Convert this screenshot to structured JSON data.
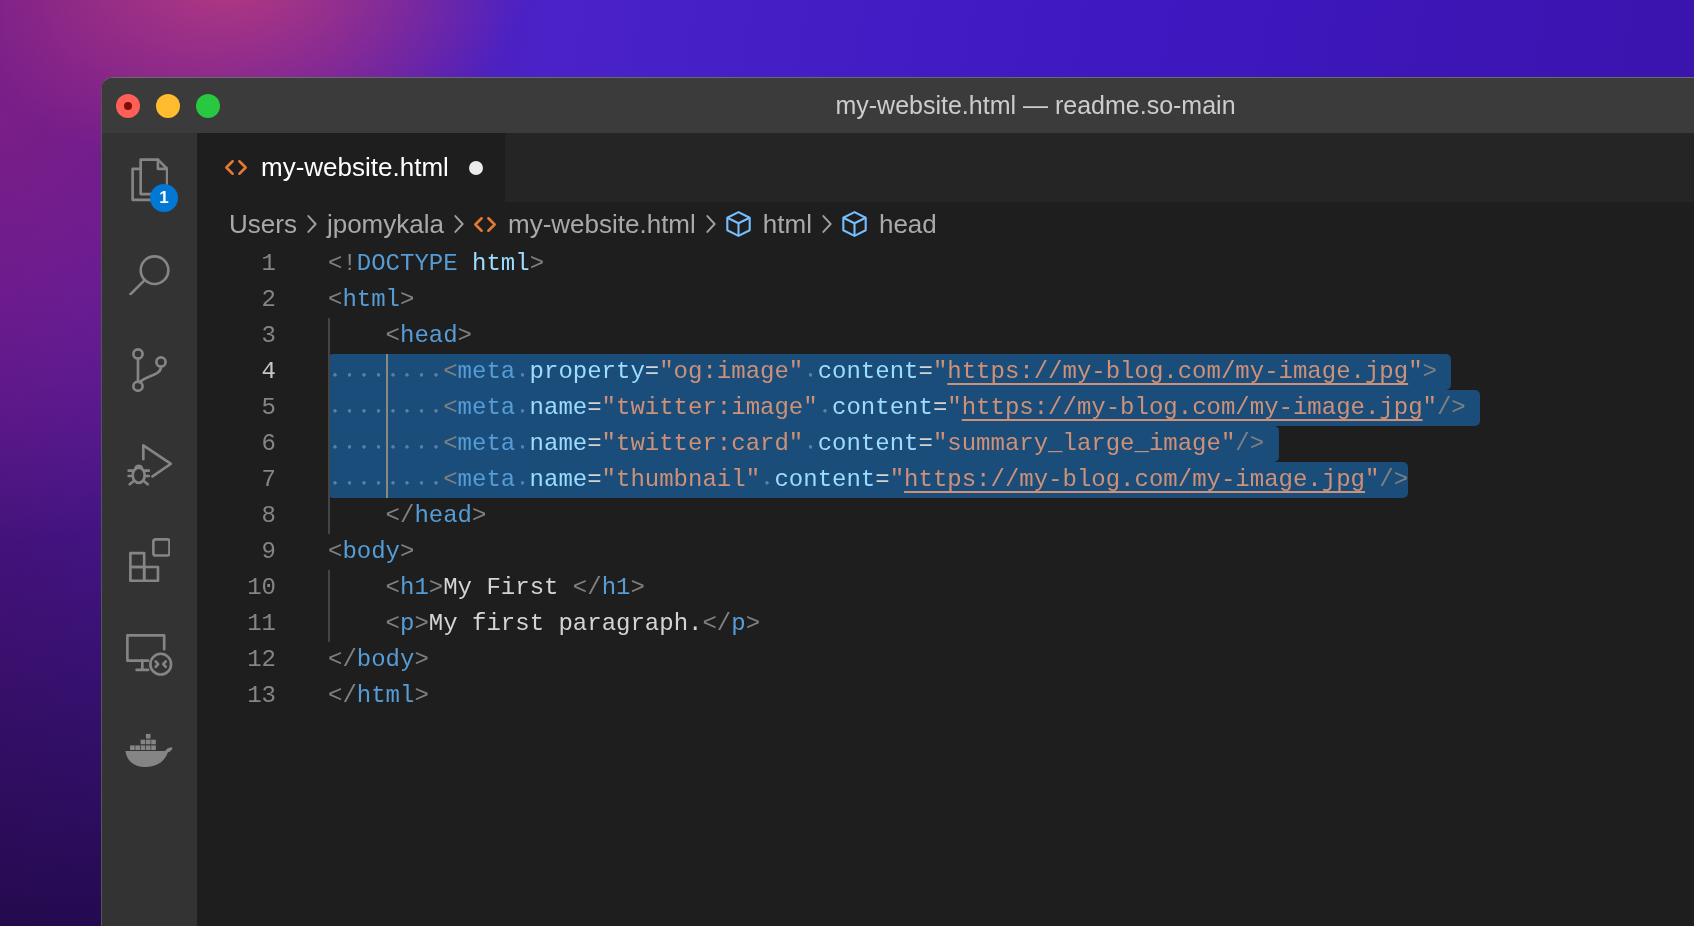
{
  "window": {
    "title": "my-website.html — readme.so-main",
    "unsaved": true
  },
  "activity_bar": [
    {
      "kind": "explorer",
      "badge": "1"
    },
    {
      "kind": "search"
    },
    {
      "kind": "scm"
    },
    {
      "kind": "debug"
    },
    {
      "kind": "extensions"
    },
    {
      "kind": "remote"
    },
    {
      "kind": "docker"
    }
  ],
  "tabs": [
    {
      "label": "my-website.html",
      "selected": true,
      "modified": true
    }
  ],
  "breadcrumbs": [
    {
      "kind": "folder",
      "label": "Users"
    },
    {
      "kind": "folder",
      "label": "jpomykala"
    },
    {
      "kind": "file",
      "label": "my-website.html"
    },
    {
      "kind": "element",
      "label": "html"
    },
    {
      "kind": "element",
      "label": "head"
    }
  ],
  "editor": {
    "lines": [
      {
        "number": "1",
        "active": false,
        "selected": false,
        "tokens": [
          {
            "kind": "punct",
            "text": "<!"
          },
          {
            "kind": "tag",
            "text": "DOCTYPE "
          },
          {
            "kind": "attr",
            "text": "html"
          },
          {
            "kind": "punct",
            "text": ">"
          }
        ]
      },
      {
        "number": "2",
        "active": false,
        "selected": false,
        "tokens": [
          {
            "kind": "punct",
            "text": "<"
          },
          {
            "kind": "tag",
            "text": "html"
          },
          {
            "kind": "punct",
            "text": ">"
          }
        ],
        "children": [
          {
            "number": "3",
            "active": false,
            "selected": false,
            "tokens": [
              {
                "kind": "punct",
                "text": "<"
              },
              {
                "kind": "tag",
                "text": "head"
              },
              {
                "kind": "punct",
                "text": ">"
              }
            ],
            "children": [
              {
                "number": "4",
                "active": true,
                "selected": true,
                "tokens": [
                  {
                    "kind": "punct",
                    "text": "<"
                  },
                  {
                    "kind": "tag",
                    "text": "meta "
                  },
                  {
                    "kind": "attr",
                    "text": "property"
                  },
                  {
                    "kind": "text",
                    "text": "="
                  },
                  {
                    "kind": "string",
                    "text": "\"og:image\" "
                  },
                  {
                    "kind": "attr",
                    "text": "content"
                  },
                  {
                    "kind": "text",
                    "text": "="
                  },
                  {
                    "kind": "string",
                    "text": "\""
                  },
                  {
                    "kind": "link",
                    "text": "https://my-blog.com/my-image.jpg"
                  },
                  {
                    "kind": "string",
                    "text": "\""
                  },
                  {
                    "kind": "punct",
                    "text": ">"
                  }
                ]
              },
              {
                "number": "5",
                "active": false,
                "selected": true,
                "tokens": [
                  {
                    "kind": "punct",
                    "text": "<"
                  },
                  {
                    "kind": "tag",
                    "text": "meta "
                  },
                  {
                    "kind": "attr",
                    "text": "name"
                  },
                  {
                    "kind": "text",
                    "text": "="
                  },
                  {
                    "kind": "string",
                    "text": "\"twitter:image\" "
                  },
                  {
                    "kind": "attr",
                    "text": "content"
                  },
                  {
                    "kind": "text",
                    "text": "="
                  },
                  {
                    "kind": "string",
                    "text": "\""
                  },
                  {
                    "kind": "link",
                    "text": "https://my-blog.com/my-image.jpg"
                  },
                  {
                    "kind": "string",
                    "text": "\""
                  },
                  {
                    "kind": "punct",
                    "text": "/>"
                  }
                ]
              },
              {
                "number": "6",
                "active": false,
                "selected": true,
                "tokens": [
                  {
                    "kind": "punct",
                    "text": "<"
                  },
                  {
                    "kind": "tag",
                    "text": "meta "
                  },
                  {
                    "kind": "attr",
                    "text": "name"
                  },
                  {
                    "kind": "text",
                    "text": "="
                  },
                  {
                    "kind": "string",
                    "text": "\"twitter:card\" "
                  },
                  {
                    "kind": "attr",
                    "text": "content"
                  },
                  {
                    "kind": "text",
                    "text": "="
                  },
                  {
                    "kind": "string",
                    "text": "\"summary_large_image\""
                  },
                  {
                    "kind": "punct",
                    "text": "/>"
                  }
                ]
              },
              {
                "number": "7",
                "active": false,
                "selected": true,
                "tokens": [
                  {
                    "kind": "punct",
                    "text": "<"
                  },
                  {
                    "kind": "tag",
                    "text": "meta "
                  },
                  {
                    "kind": "attr",
                    "text": "name"
                  },
                  {
                    "kind": "text",
                    "text": "="
                  },
                  {
                    "kind": "string",
                    "text": "\"thumbnail\" "
                  },
                  {
                    "kind": "attr",
                    "text": "content"
                  },
                  {
                    "kind": "text",
                    "text": "="
                  },
                  {
                    "kind": "string",
                    "text": "\""
                  },
                  {
                    "kind": "link",
                    "text": "https://my-blog.com/my-image.jpg"
                  },
                  {
                    "kind": "string",
                    "text": "\""
                  },
                  {
                    "kind": "punct",
                    "text": "/>"
                  }
                ]
              }
            ]
          },
          {
            "number": "8",
            "active": false,
            "selected": false,
            "tokens": [
              {
                "kind": "punct",
                "text": "</"
              },
              {
                "kind": "tag",
                "text": "head"
              },
              {
                "kind": "punct",
                "text": ">"
              }
            ]
          }
        ]
      },
      {
        "number": "9",
        "active": false,
        "selected": false,
        "tokens": [
          {
            "kind": "punct",
            "text": "<"
          },
          {
            "kind": "tag",
            "text": "body"
          },
          {
            "kind": "punct",
            "text": ">"
          }
        ],
        "children": [
          {
            "number": "10",
            "active": false,
            "selected": false,
            "tokens": [
              {
                "kind": "punct",
                "text": "<"
              },
              {
                "kind": "tag",
                "text": "h1"
              },
              {
                "kind": "punct",
                "text": ">"
              },
              {
                "kind": "text",
                "text": "My First "
              },
              {
                "kind": "punct",
                "text": "</"
              },
              {
                "kind": "tag",
                "text": "h1"
              },
              {
                "kind": "punct",
                "text": ">"
              }
            ]
          },
          {
            "number": "11",
            "active": false,
            "selected": false,
            "tokens": [
              {
                "kind": "punct",
                "text": "<"
              },
              {
                "kind": "tag",
                "text": "p"
              },
              {
                "kind": "punct",
                "text": ">"
              },
              {
                "kind": "text",
                "text": "My first paragraph."
              },
              {
                "kind": "punct",
                "text": "</"
              },
              {
                "kind": "tag",
                "text": "p"
              },
              {
                "kind": "punct",
                "text": ">"
              }
            ]
          }
        ]
      },
      {
        "number": "12",
        "active": false,
        "selected": false,
        "tokens": [
          {
            "kind": "punct",
            "text": "</"
          },
          {
            "kind": "tag",
            "text": "body"
          },
          {
            "kind": "punct",
            "text": ">"
          }
        ]
      },
      {
        "number": "13",
        "active": false,
        "selected": false,
        "tokens": [
          {
            "kind": "punct",
            "text": "</"
          },
          {
            "kind": "tag",
            "text": "html"
          },
          {
            "kind": "punct",
            "text": ">"
          }
        ]
      }
    ]
  }
}
